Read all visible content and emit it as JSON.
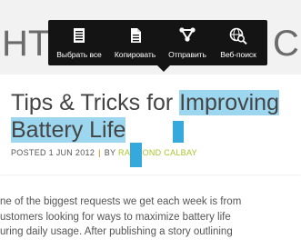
{
  "site_logo": {
    "partial": "НТ",
    "tail": "C"
  },
  "article": {
    "title_line1_plain": "Tips & Tricks for ",
    "title_line1_selected": "Improving",
    "title_line2_selected": "Battery Life",
    "meta_posted": "POSTED 1 JUN 2012",
    "meta_separator": "|",
    "meta_by": "BY ",
    "meta_author": "RAYMOND CALBAY",
    "body_lines": [
      "ne of the biggest requests we get each week is from",
      "ustomers looking for ways to maximize battery life",
      "uring daily usage.  After publishing a story outlining",
      "                                                               "
    ]
  },
  "toolbar": {
    "items": [
      {
        "label": "Выбрать все",
        "icon": "select-all-icon"
      },
      {
        "label": "Копировать",
        "icon": "copy-icon"
      },
      {
        "label": "Отправить",
        "icon": "share-icon"
      },
      {
        "label": "Веб-поиск",
        "icon": "web-search-icon"
      }
    ]
  },
  "colors": {
    "selection": "#9dd6ef",
    "handle": "#35a8dc",
    "toolbar_bg": "#141414",
    "author": "#a7c62b",
    "separator": "#e06a00"
  }
}
